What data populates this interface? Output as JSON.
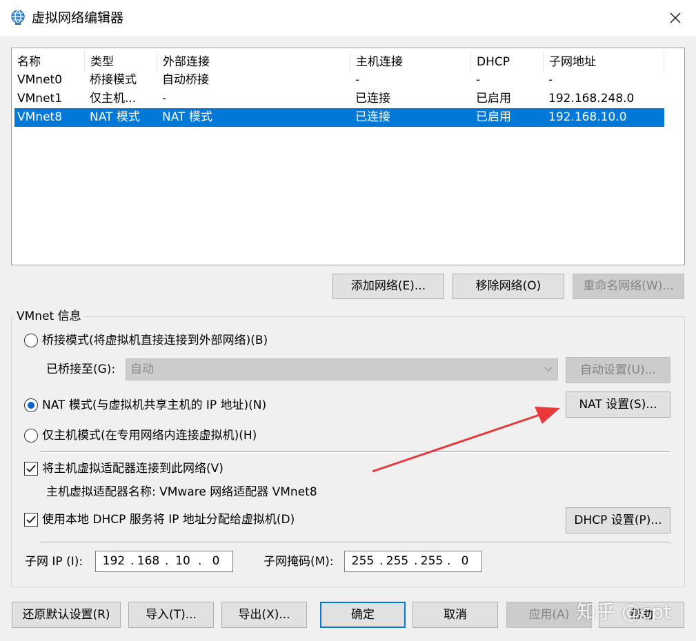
{
  "window": {
    "title": "虚拟网络编辑器",
    "icon": "globe-network-icon",
    "close_icon": "close-icon"
  },
  "table": {
    "headers": [
      "名称",
      "类型",
      "外部连接",
      "主机连接",
      "DHCP",
      "子网地址"
    ],
    "rows": [
      {
        "name": "VMnet0",
        "type": "桥接模式",
        "external": "自动桥接",
        "host": "-",
        "dhcp": "-",
        "subnet": "-",
        "selected": false
      },
      {
        "name": "VMnet1",
        "type": "仅主机...",
        "external": "-",
        "host": "已连接",
        "dhcp": "已启用",
        "subnet": "192.168.248.0",
        "selected": false
      },
      {
        "name": "VMnet8",
        "type": "NAT 模式",
        "external": "NAT 模式",
        "host": "已连接",
        "dhcp": "已启用",
        "subnet": "192.168.10.0",
        "selected": true
      }
    ]
  },
  "list_buttons": {
    "add": "添加网络(E)...",
    "remove": "移除网络(O)",
    "rename": "重命名网络(W)..."
  },
  "vmnet_info": {
    "group_title": "VMnet 信息",
    "bridge_radio": "桥接模式(将虚拟机直接连接到外部网络)(B)",
    "bridged_to_label": "已桥接至(G):",
    "bridged_to_value": "自动",
    "auto_settings": "自动设置(U)...",
    "nat_radio": "NAT 模式(与虚拟机共享主机的 IP 地址)(N)",
    "nat_settings": "NAT 设置(S)...",
    "host_only_radio": "仅主机模式(在专用网络内连接虚拟机)(H)",
    "selected_mode": "nat",
    "connect_adapter": "将主机虚拟适配器连接到此网络(V)",
    "connect_adapter_checked": true,
    "adapter_name": "主机虚拟适配器名称: VMware 网络适配器 VMnet8",
    "use_dhcp": "使用本地 DHCP 服务将 IP 地址分配给虚拟机(D)",
    "use_dhcp_checked": true,
    "dhcp_settings": "DHCP 设置(P)...",
    "subnet_ip_label": "子网 IP (I):",
    "subnet_ip": [
      "192",
      "168",
      "10",
      "0"
    ],
    "subnet_mask_label": "子网掩码(M):",
    "subnet_mask": [
      "255",
      "255",
      "255",
      "0"
    ]
  },
  "footer": {
    "restore": "还原默认设置(R)",
    "import": "导入(T)...",
    "export": "导出(X)...",
    "ok": "确定",
    "cancel": "取消",
    "apply": "应用(A)",
    "help": "帮助"
  },
  "annotation": {
    "arrow_color": "#e8383a"
  },
  "watermark": "知乎 @cpt"
}
